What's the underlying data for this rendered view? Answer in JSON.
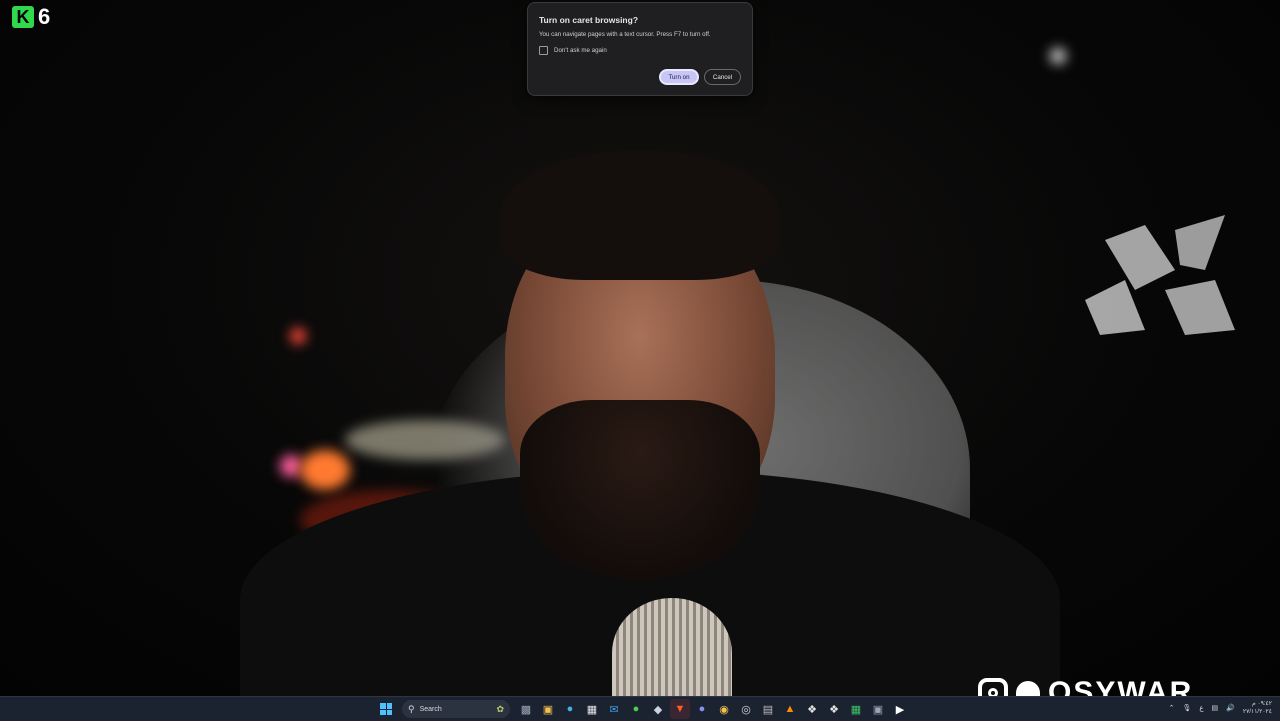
{
  "overlay": {
    "logo_letter": "K",
    "logo_number": "6",
    "social_handle": "OSYWAR",
    "colors": {
      "logo_green": "#2fd94b"
    }
  },
  "dialog": {
    "title": "Turn on caret browsing?",
    "body": "You can navigate pages with a text cursor. Press F7 to turn off.",
    "checkbox_label": "Don't ask me again",
    "checkbox_checked": false,
    "primary_button": "Turn on",
    "secondary_button": "Cancel",
    "colors": {
      "primary_bg": "#c8c6f5",
      "dialog_bg": "#1f1f21"
    }
  },
  "taskbar": {
    "search_placeholder": "Search",
    "apps": [
      {
        "icon": "file-explorer-icon"
      },
      {
        "icon": "folder-icon"
      },
      {
        "icon": "edge-icon"
      },
      {
        "icon": "store-icon"
      },
      {
        "icon": "mail-icon"
      },
      {
        "icon": "xbox-icon"
      },
      {
        "icon": "steam-icon"
      },
      {
        "icon": "brave-icon"
      },
      {
        "icon": "discord-icon"
      },
      {
        "icon": "chrome-icon"
      },
      {
        "icon": "obs-icon"
      },
      {
        "icon": "terminal-icon"
      },
      {
        "icon": "vlc-icon"
      },
      {
        "icon": "app-icon"
      },
      {
        "icon": "app-icon"
      },
      {
        "icon": "excel-icon"
      },
      {
        "icon": "app-icon"
      },
      {
        "icon": "media-player-icon"
      }
    ],
    "tray": {
      "lang": "ع",
      "time": "٠٩:٤٢ م",
      "date": "٢٧/١١/٢٠٢٤"
    }
  }
}
